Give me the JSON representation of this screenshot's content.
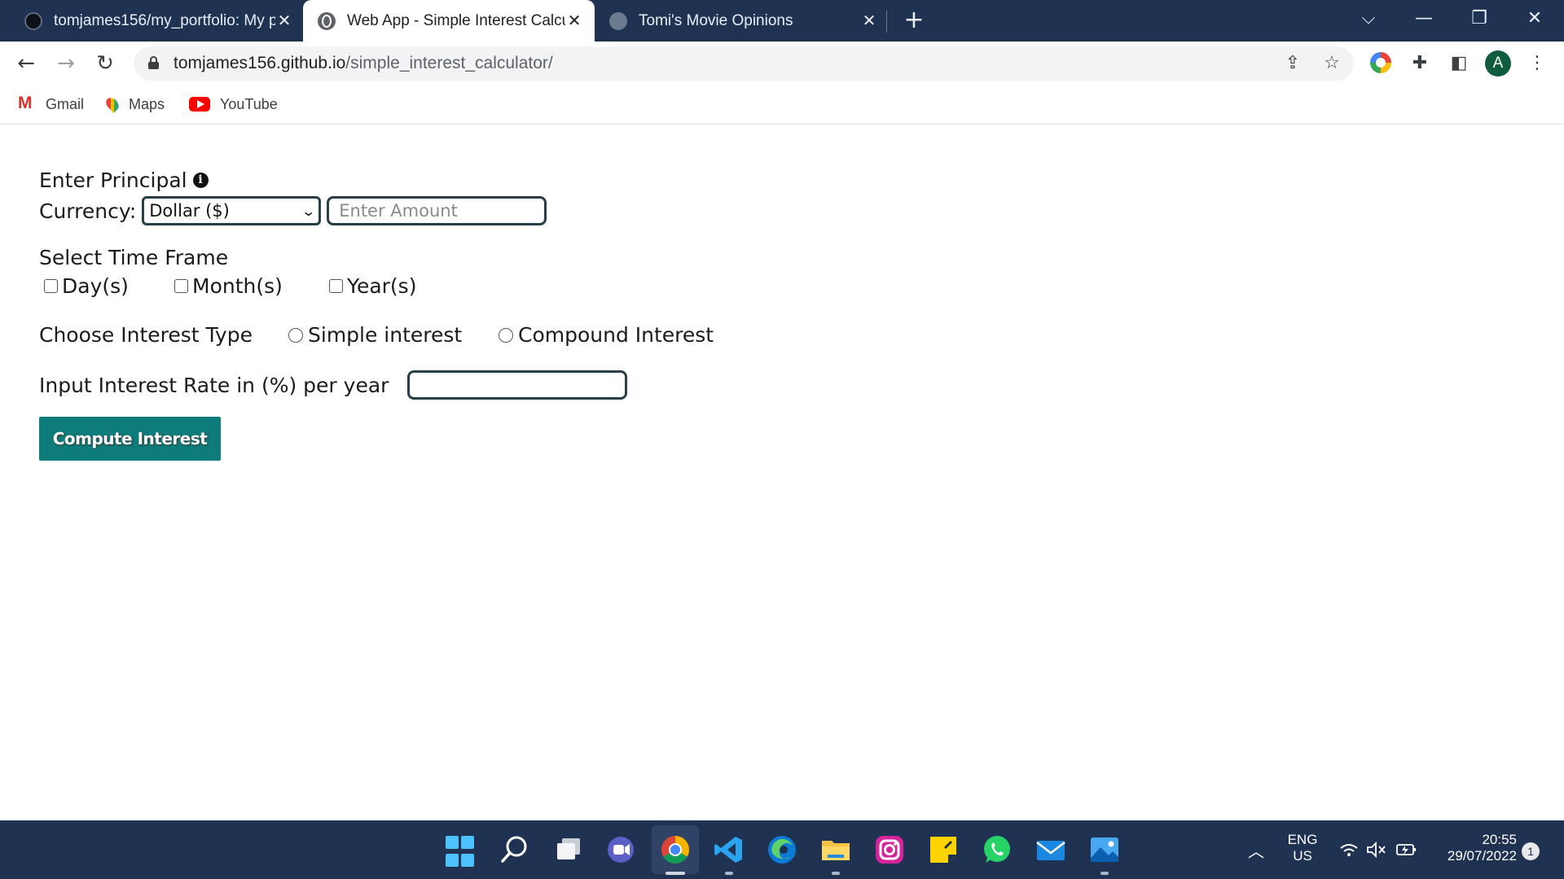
{
  "browser": {
    "tabs": [
      {
        "title": "tomjames156/my_portfolio: My p",
        "icon": "github-icon"
      },
      {
        "title": "Web App - Simple Interest Calcul",
        "icon": "globe-icon"
      },
      {
        "title": "Tomi's Movie Opinions",
        "icon": "globe-icon"
      }
    ],
    "url_host": "tomjames156.github.io",
    "url_path": "/simple_interest_calculator/",
    "profile_initial": "A",
    "bookmarks": [
      {
        "label": "Gmail",
        "icon": "gmail-icon"
      },
      {
        "label": "Maps",
        "icon": "maps-icon"
      },
      {
        "label": "YouTube",
        "icon": "youtube-icon"
      }
    ]
  },
  "form": {
    "principal_heading": "Enter Principal",
    "currency_label": "Currency:",
    "currency_selected": "Dollar ($)",
    "amount_placeholder": "Enter Amount",
    "timeframe_heading": "Select Time Frame",
    "timeframe_options": [
      "Day(s)",
      "Month(s)",
      "Year(s)"
    ],
    "interest_type_label": "Choose Interest Type",
    "interest_options": [
      "Simple interest",
      "Compound Interest"
    ],
    "rate_label": "Input Interest Rate in (%) per year",
    "compute_button": "Compute Interest"
  },
  "taskbar": {
    "language": "ENG",
    "region": "US",
    "time": "20:55",
    "date": "29/07/2022",
    "notifications": "1"
  },
  "colors": {
    "titlebar": "#1f3251",
    "button": "#0e7c7b",
    "input_border": "#274047"
  }
}
